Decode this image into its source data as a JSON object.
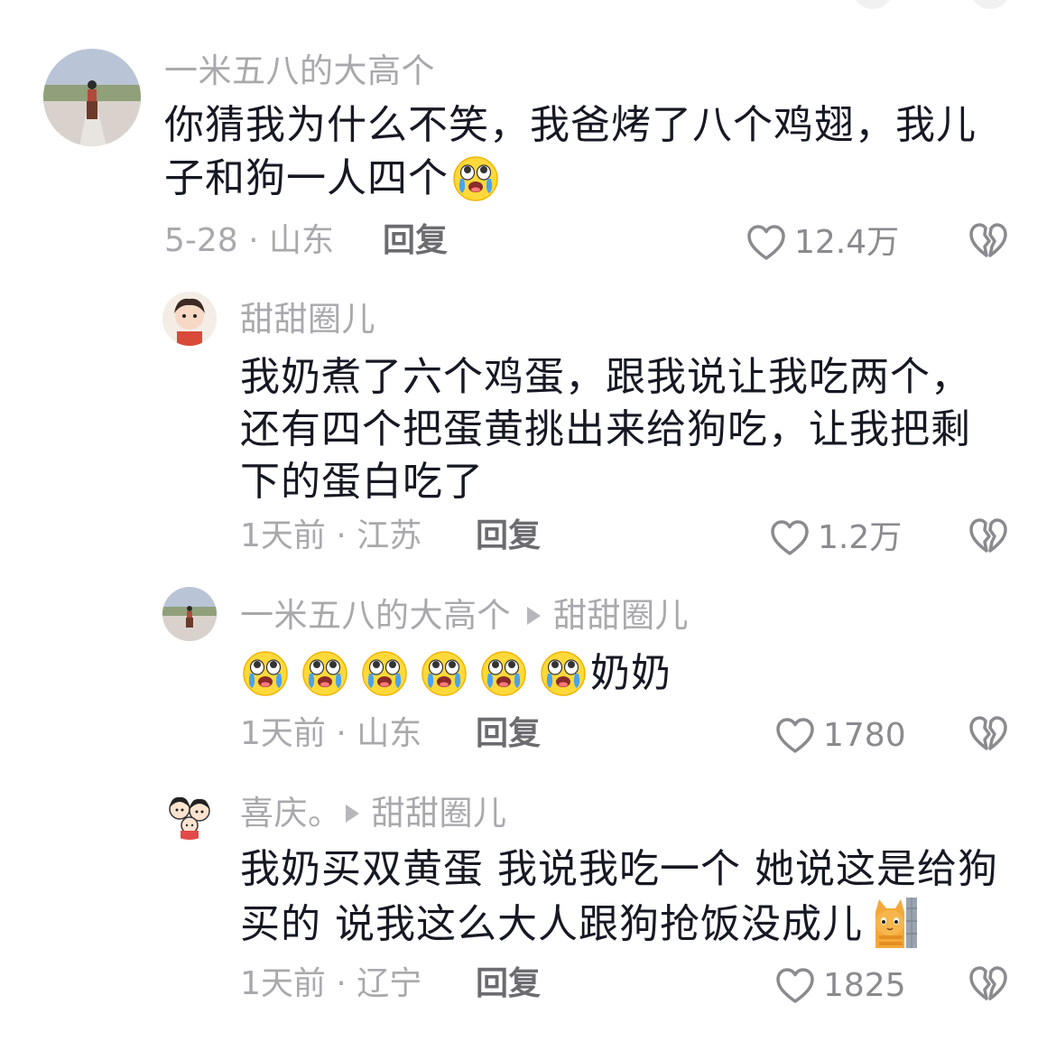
{
  "comments": [
    {
      "user": "一米五八的大高个",
      "text_lines": [
        "你猜我为什么不笑，我爸烤了八个鸡翅，我儿",
        "子和狗一人四个"
      ],
      "meta": "5-28 · 山东",
      "reply": "回复",
      "likes": "12.4万"
    },
    {
      "user": "甜甜圈儿",
      "text_lines": [
        "我奶煮了六个鸡蛋，跟我说让我吃两个，",
        "还有四个把蛋黄挑出来给狗吃，让我把剩",
        "下的蛋白吃了"
      ],
      "meta": "1天前 · 江苏",
      "reply": "回复",
      "likes": "1.2万"
    },
    {
      "user": "一米五八的大高个",
      "reply_to": "甜甜圈儿",
      "text": "奶奶",
      "meta": "1天前 · 山东",
      "reply": "回复",
      "likes": "1780"
    },
    {
      "user": "喜庆。",
      "reply_to": "甜甜圈儿",
      "text_lines": [
        "我奶买双黄蛋 我说我吃一个 她说这是给狗",
        "买的 说我这么大人跟狗抢饭没成儿"
      ],
      "meta": "1天前 · 辽宁",
      "reply": "回复",
      "likes": "1825"
    }
  ],
  "icons": {
    "like": "heart-outline-icon",
    "dislike": "broken-heart-icon",
    "emoji": "crying-emoji",
    "sticker": "cat-peeking-sticker"
  },
  "colors": {
    "text": "#161823",
    "secondary": "#a9a9ad",
    "emoji_face": "#ffd93a",
    "tear": "#4aa3ef"
  }
}
